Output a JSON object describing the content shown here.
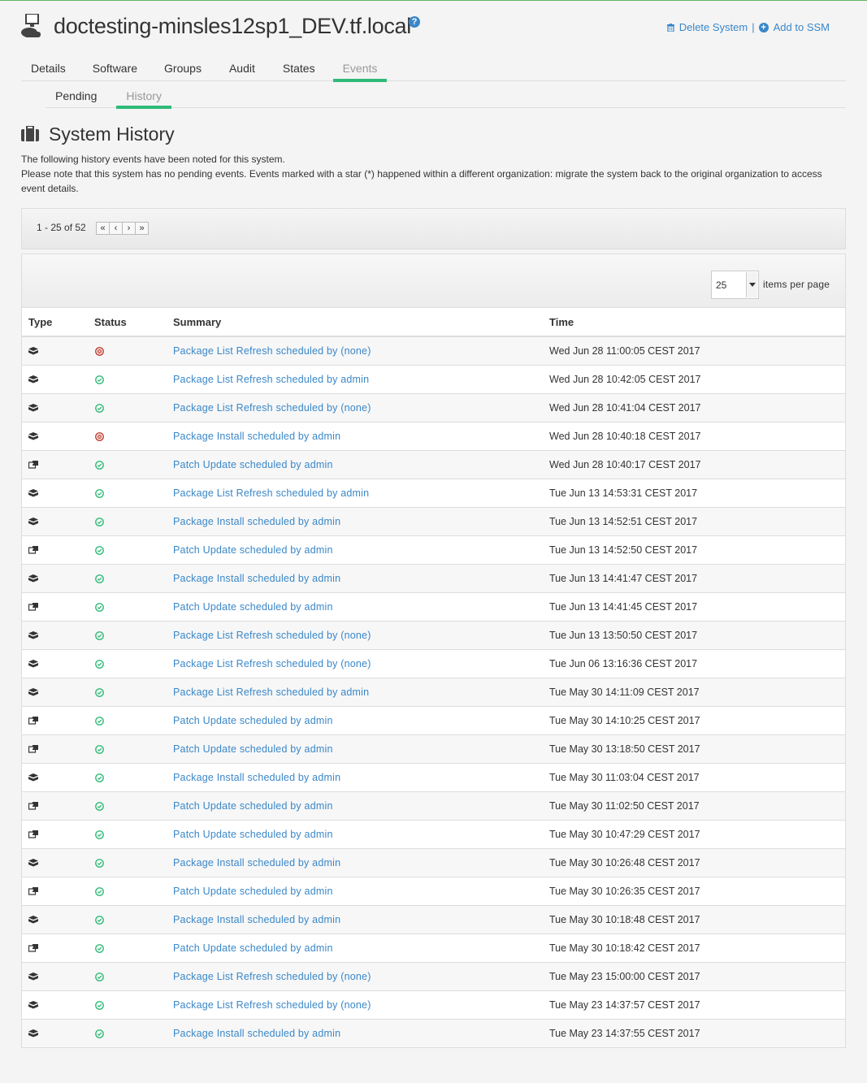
{
  "header": {
    "title": "doctesting-minsles12sp1_DEV.tf.local",
    "delete_label": "Delete System",
    "separator": "|",
    "ssm_label": "Add to SSM"
  },
  "tabs": [
    {
      "label": "Details",
      "active": false
    },
    {
      "label": "Software",
      "active": false
    },
    {
      "label": "Groups",
      "active": false
    },
    {
      "label": "Audit",
      "active": false
    },
    {
      "label": "States",
      "active": false
    },
    {
      "label": "Events",
      "active": true
    }
  ],
  "subtabs": [
    {
      "label": "Pending",
      "active": false
    },
    {
      "label": "History",
      "active": true
    }
  ],
  "section": {
    "title": "System History",
    "description_1": "The following history events have been noted for this system.",
    "description_2": "Please note that this system has no pending events. Events marked with a star (*) happened within a different organization: migrate the system back to the original organization to access event details."
  },
  "pager": {
    "range_text": "1 - 25 of 52",
    "first": "«",
    "prev": "‹",
    "next": "›",
    "last": "»"
  },
  "items_per_page": {
    "value": "25",
    "label": "items per page"
  },
  "table": {
    "columns": [
      "Type",
      "Status",
      "Summary",
      "Time"
    ],
    "rows": [
      {
        "type": "package",
        "status": "failed",
        "summary": "Package List Refresh scheduled by (none)",
        "time": "Wed Jun 28 11:00:05 CEST 2017"
      },
      {
        "type": "package",
        "status": "completed",
        "summary": "Package List Refresh scheduled by admin",
        "time": "Wed Jun 28 10:42:05 CEST 2017"
      },
      {
        "type": "package",
        "status": "completed",
        "summary": "Package List Refresh scheduled by (none)",
        "time": "Wed Jun 28 10:41:04 CEST 2017"
      },
      {
        "type": "package",
        "status": "failed",
        "summary": "Package Install scheduled by admin",
        "time": "Wed Jun 28 10:40:18 CEST 2017"
      },
      {
        "type": "patch",
        "status": "completed",
        "summary": "Patch Update scheduled by admin",
        "time": "Wed Jun 28 10:40:17 CEST 2017"
      },
      {
        "type": "package",
        "status": "completed",
        "summary": "Package List Refresh scheduled by admin",
        "time": "Tue Jun 13 14:53:31 CEST 2017"
      },
      {
        "type": "package",
        "status": "completed",
        "summary": "Package Install scheduled by admin",
        "time": "Tue Jun 13 14:52:51 CEST 2017"
      },
      {
        "type": "patch",
        "status": "completed",
        "summary": "Patch Update scheduled by admin",
        "time": "Tue Jun 13 14:52:50 CEST 2017"
      },
      {
        "type": "package",
        "status": "completed",
        "summary": "Package Install scheduled by admin",
        "time": "Tue Jun 13 14:41:47 CEST 2017"
      },
      {
        "type": "patch",
        "status": "completed",
        "summary": "Patch Update scheduled by admin",
        "time": "Tue Jun 13 14:41:45 CEST 2017"
      },
      {
        "type": "package",
        "status": "completed",
        "summary": "Package List Refresh scheduled by (none)",
        "time": "Tue Jun 13 13:50:50 CEST 2017"
      },
      {
        "type": "package",
        "status": "completed",
        "summary": "Package List Refresh scheduled by (none)",
        "time": "Tue Jun 06 13:16:36 CEST 2017"
      },
      {
        "type": "package",
        "status": "completed",
        "summary": "Package List Refresh scheduled by admin",
        "time": "Tue May 30 14:11:09 CEST 2017"
      },
      {
        "type": "patch",
        "status": "completed",
        "summary": "Patch Update scheduled by admin",
        "time": "Tue May 30 14:10:25 CEST 2017"
      },
      {
        "type": "patch",
        "status": "completed",
        "summary": "Patch Update scheduled by admin",
        "time": "Tue May 30 13:18:50 CEST 2017"
      },
      {
        "type": "package",
        "status": "completed",
        "summary": "Package Install scheduled by admin",
        "time": "Tue May 30 11:03:04 CEST 2017"
      },
      {
        "type": "patch",
        "status": "completed",
        "summary": "Patch Update scheduled by admin",
        "time": "Tue May 30 11:02:50 CEST 2017"
      },
      {
        "type": "patch",
        "status": "completed",
        "summary": "Patch Update scheduled by admin",
        "time": "Tue May 30 10:47:29 CEST 2017"
      },
      {
        "type": "package",
        "status": "completed",
        "summary": "Package Install scheduled by admin",
        "time": "Tue May 30 10:26:48 CEST 2017"
      },
      {
        "type": "patch",
        "status": "completed",
        "summary": "Patch Update scheduled by admin",
        "time": "Tue May 30 10:26:35 CEST 2017"
      },
      {
        "type": "package",
        "status": "completed",
        "summary": "Package Install scheduled by admin",
        "time": "Tue May 30 10:18:48 CEST 2017"
      },
      {
        "type": "patch",
        "status": "completed",
        "summary": "Patch Update scheduled by admin",
        "time": "Tue May 30 10:18:42 CEST 2017"
      },
      {
        "type": "package",
        "status": "completed",
        "summary": "Package List Refresh scheduled by (none)",
        "time": "Tue May 23 15:00:00 CEST 2017"
      },
      {
        "type": "package",
        "status": "completed",
        "summary": "Package List Refresh scheduled by (none)",
        "time": "Tue May 23 14:37:57 CEST 2017"
      },
      {
        "type": "package",
        "status": "completed",
        "summary": "Package Install scheduled by admin",
        "time": "Tue May 23 14:37:55 CEST 2017"
      }
    ]
  },
  "colors": {
    "accent_green": "#30ba78",
    "link_blue": "#3a87c8",
    "status_ok": "#30ba78",
    "status_failed": "#c0392b"
  }
}
